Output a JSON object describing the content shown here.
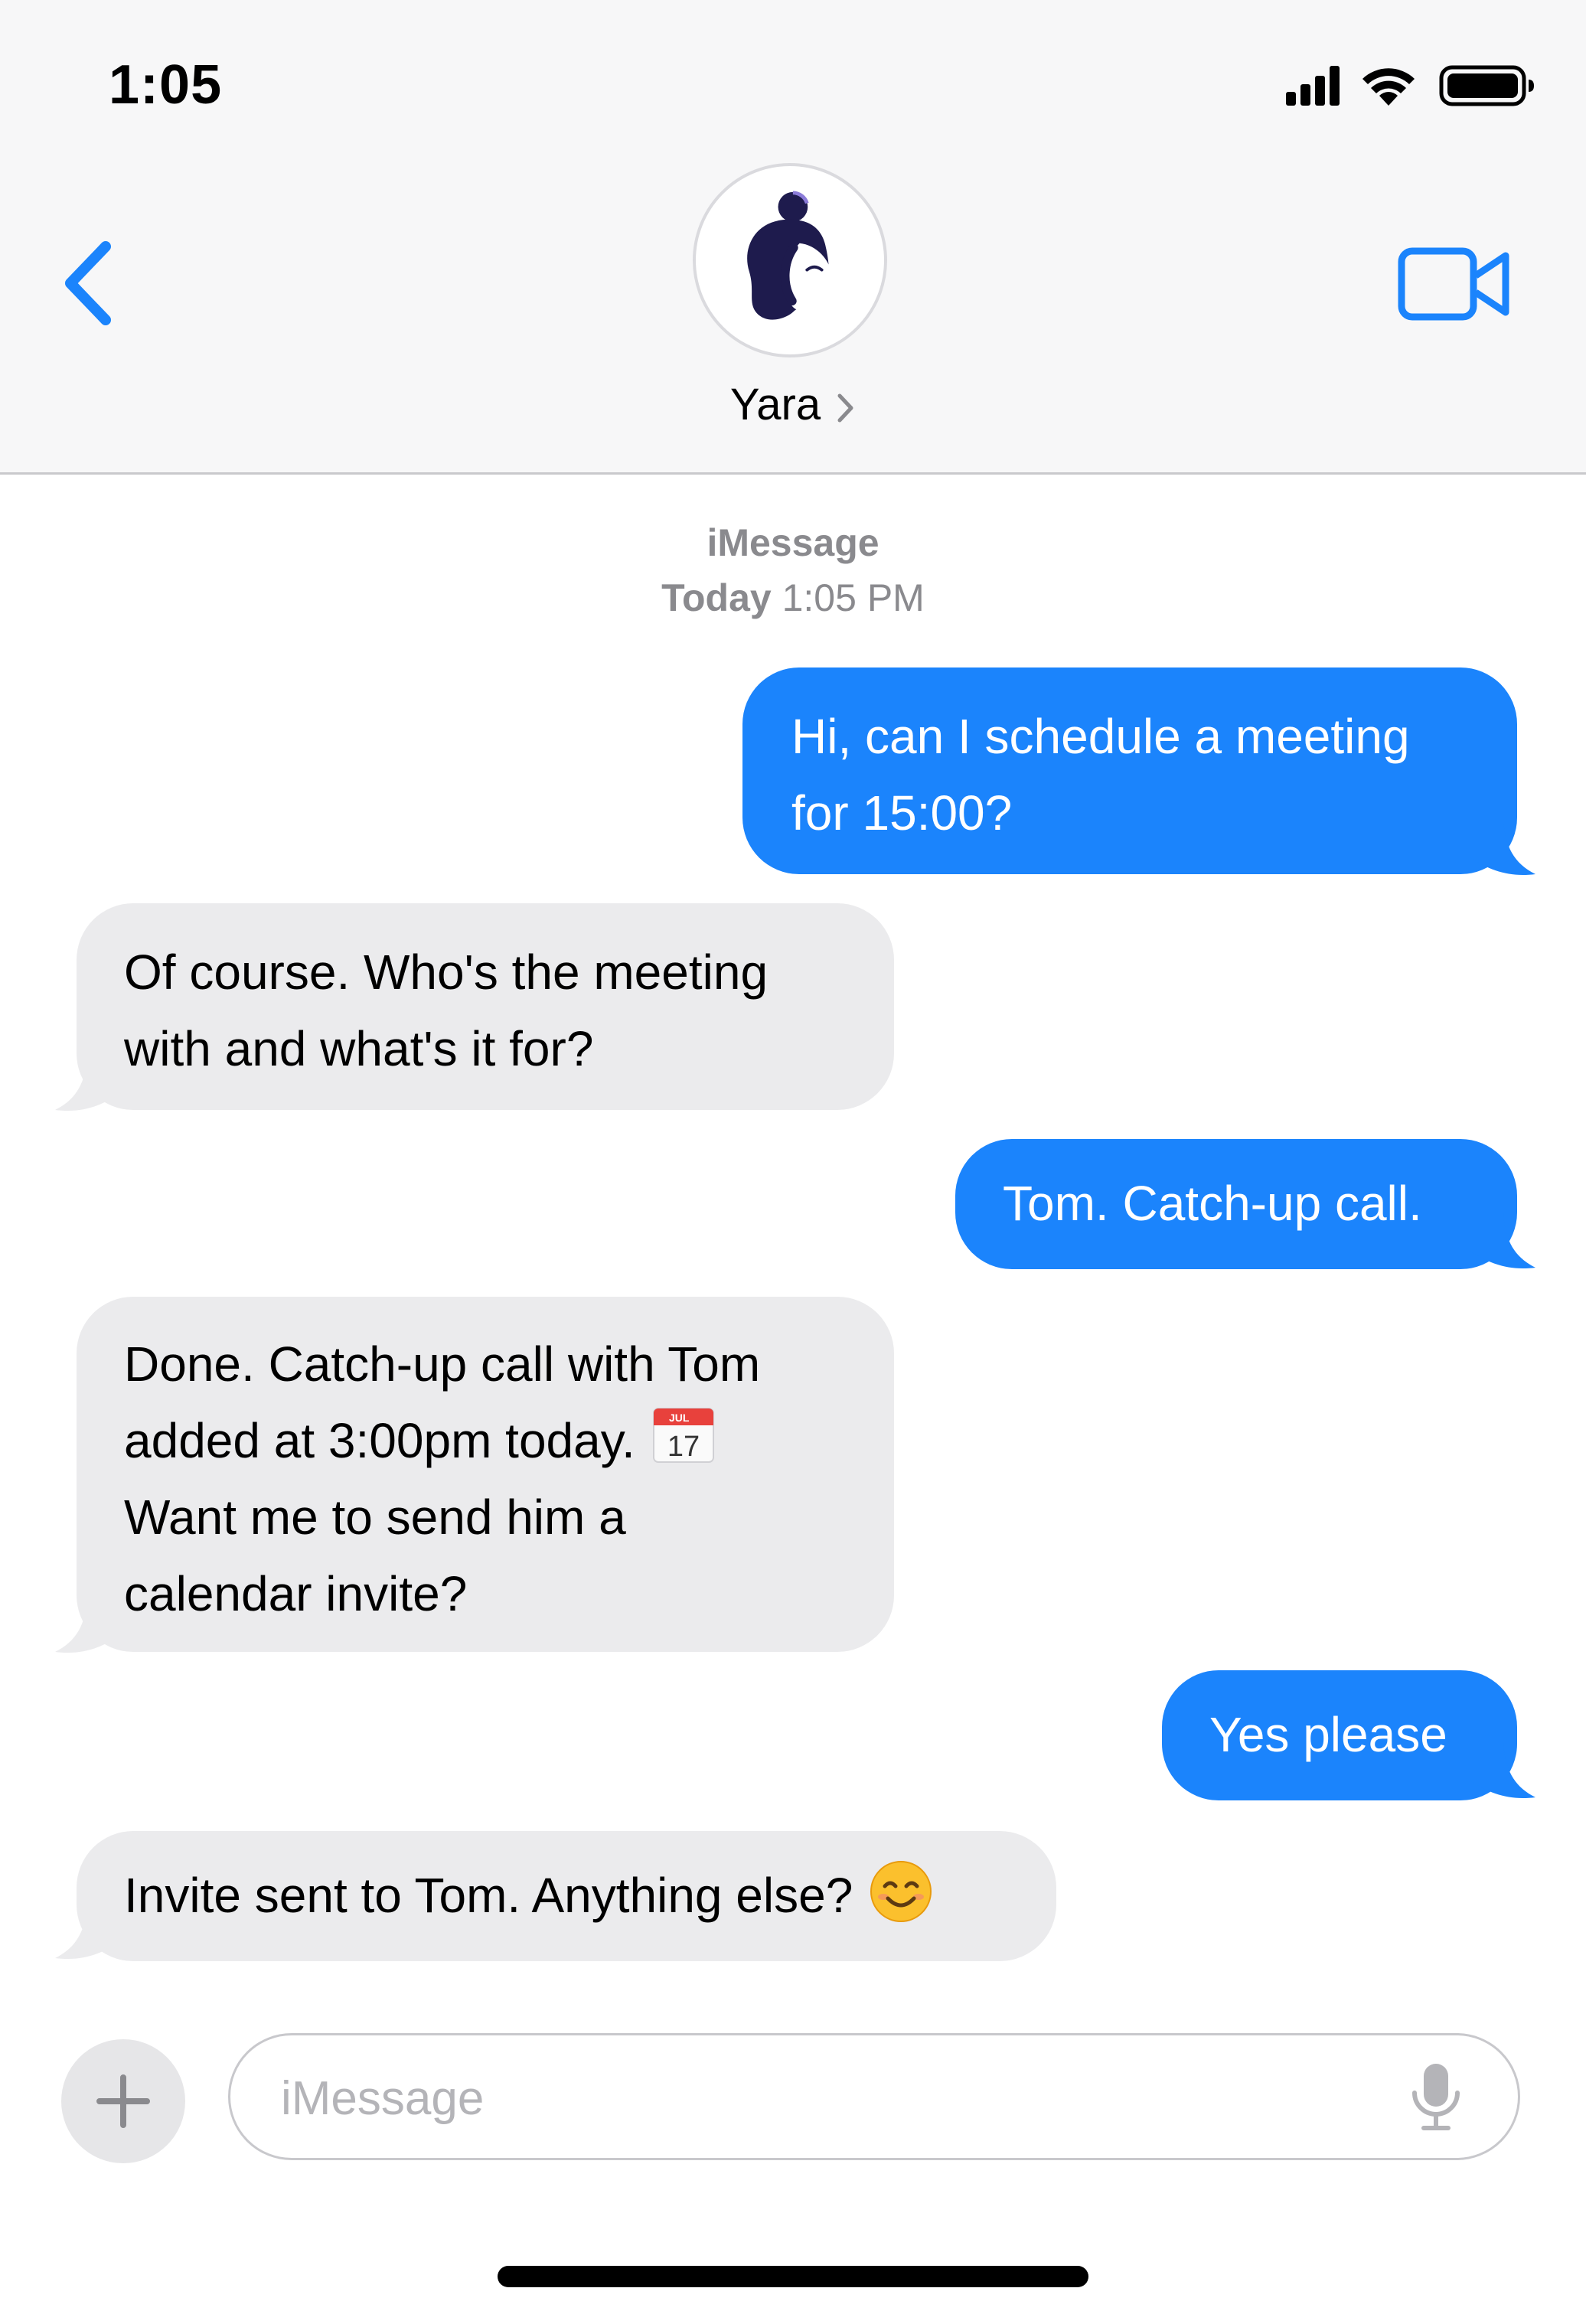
{
  "status_bar": {
    "time": "1:05"
  },
  "header": {
    "contact_name": "Yara",
    "back_icon": "chevron-left-icon",
    "video_icon": "video-camera-icon",
    "accent_color": "#1b84fc"
  },
  "thread": {
    "service": "iMessage",
    "timestamp_day": "Today",
    "timestamp_time": "1:05 PM"
  },
  "messages": [
    {
      "from": "me",
      "lines": [
        "Hi, can I schedule a meeting",
        "for 15:00?"
      ]
    },
    {
      "from": "contact",
      "lines": [
        "Of course. Who's the meeting",
        "with and what's it for?"
      ]
    },
    {
      "from": "me",
      "lines": [
        "Tom. Catch-up call."
      ]
    },
    {
      "from": "contact",
      "lines": [
        "Done. Catch-up call with Tom",
        "added at 3:00pm today.",
        "Want me to send him a",
        "calendar invite?"
      ],
      "emoji": "calendar-icon",
      "calendar_month": "JUL",
      "calendar_day": "17"
    },
    {
      "from": "me",
      "lines": [
        "Yes please"
      ]
    },
    {
      "from": "contact",
      "lines": [
        "Invite sent to Tom. Anything else?"
      ],
      "emoji": "smiling-face-icon"
    }
  ],
  "composer": {
    "placeholder": "iMessage",
    "plus_icon": "plus-icon",
    "mic_icon": "microphone-icon"
  }
}
